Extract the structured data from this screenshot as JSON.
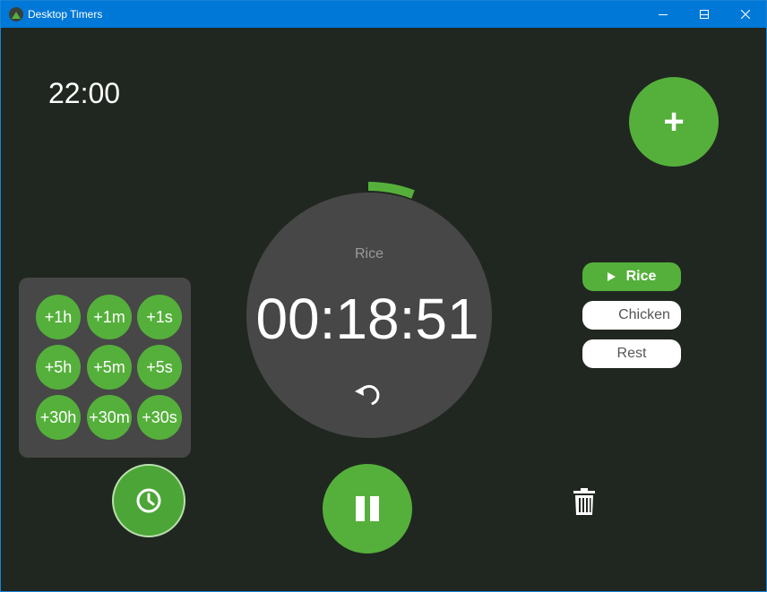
{
  "window": {
    "title": "Desktop Timers",
    "icon": "app-icon",
    "controls": [
      "minimize-icon",
      "maximize-icon",
      "close-icon"
    ]
  },
  "clock": {
    "time": "22:00"
  },
  "add_button": {
    "icon": "plus-icon",
    "label": "+"
  },
  "active_timer": {
    "name": "Rice",
    "remaining": "00:18:51",
    "reset_icon": "reset-icon"
  },
  "increment_buttons": [
    {
      "label": "+1h"
    },
    {
      "label": "+1m"
    },
    {
      "label": "+1s"
    },
    {
      "label": "+5h"
    },
    {
      "label": "+5m"
    },
    {
      "label": "+5s"
    },
    {
      "label": "+30h"
    },
    {
      "label": "+30m"
    },
    {
      "label": "+30s"
    }
  ],
  "timer_list": [
    {
      "label": "Rice",
      "active": true,
      "icon": "play-icon"
    },
    {
      "label": "Chicken",
      "active": false
    },
    {
      "label": "Rest",
      "active": false
    }
  ],
  "bottom_controls": {
    "alarm_icon": "clock-icon",
    "pause_icon": "pause-icon",
    "delete_icon": "trash-icon"
  },
  "colors": {
    "background": "#202720",
    "accent": "#55b03b",
    "dial": "#474747",
    "titlebar": "#0078d7"
  }
}
